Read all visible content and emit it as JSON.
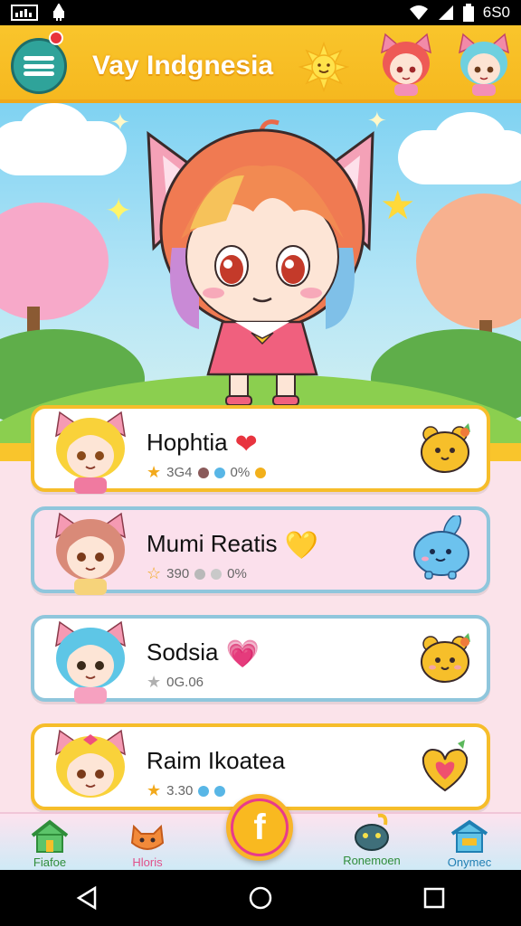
{
  "status_bar": {
    "time": "6S0"
  },
  "header": {
    "title": "Vay Indgnesia"
  },
  "cards": [
    {
      "name": "Hophtia",
      "heart": "❤",
      "heart_color": "#e8343f",
      "stats": {
        "stars": "3G4",
        "value": "0%"
      }
    },
    {
      "name": "Mumi Reatis",
      "heart": "💛",
      "heart_color": "#8a72d6",
      "stats": {
        "stars": "390",
        "value": "0%"
      }
    },
    {
      "name": "Sodsia",
      "heart": "💗",
      "heart_color": "#ef5aa0",
      "stats": {
        "stars": "",
        "value": "0G.06"
      }
    },
    {
      "name": "Raim Ikoatea",
      "heart": "",
      "stats": {
        "stars": "3.30",
        "value": ""
      }
    }
  ],
  "bottom_nav": {
    "items": [
      {
        "label": "Fiafoe",
        "color": "#2f8d3a"
      },
      {
        "label": "Hloris",
        "color": "#e0508a"
      },
      {
        "label": "Ronemoen",
        "color": "#2f8d3a"
      },
      {
        "label": "Onymec",
        "color": "#1f7fb3"
      }
    ],
    "fab_glyph": "f"
  },
  "colors": {
    "header": "#f9c52c",
    "accent": "#2fa39a"
  }
}
